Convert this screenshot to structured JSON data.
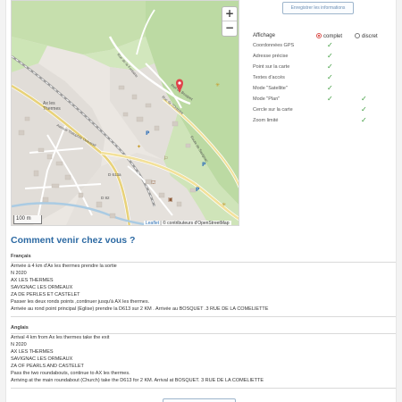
{
  "top_button": {
    "label": "Enregistrer les informations"
  },
  "map": {
    "zoom_in": "+",
    "zoom_out": "−",
    "scale": "100 m",
    "attribution_leaflet": "Leaflet",
    "attribution_osm": " | © contributeurs d'OpenStreetMap",
    "labels": {
      "ax": "Ax les Thermes",
      "road1": "Avenue Théophile Delcassé",
      "road2": "Rue de la Fontaine",
      "road3": "D 613a",
      "road4": "D 82",
      "road5": "Route de Savignac",
      "road6": "Rue de l'Oratoire",
      "road7": "Rue du Bosquet"
    }
  },
  "display_options": {
    "header": "Affichage",
    "mode_complet": "complet",
    "mode_discret": "discret",
    "rows": [
      {
        "label": "Coordonnées GPS",
        "complet": true,
        "discret": false
      },
      {
        "label": "Adresse précise",
        "complet": true,
        "discret": false
      },
      {
        "label": "Point sur la carte",
        "complet": true,
        "discret": false
      },
      {
        "label": "Textes d'accès",
        "complet": true,
        "discret": false
      },
      {
        "label": "Mode \"Satellite\"",
        "complet": true,
        "discret": false
      },
      {
        "label": "Mode \"Plan\"",
        "complet": true,
        "discret": true
      },
      {
        "label": "Cercle sur la carte",
        "complet": false,
        "discret": true
      },
      {
        "label": "Zoom limité",
        "complet": false,
        "discret": true
      }
    ]
  },
  "directions": {
    "title": "Comment venir chez vous ?",
    "francais": {
      "lang": "Français",
      "lines": [
        "Arrivée à 4 km d'Ax les thermes prendre la sortie",
        "N 2020",
        "AX LES THERMES",
        "SAVIGNAC LES ORMEAUX",
        "ZA DE PERLES ET CASTELET",
        "Passer les deux ronds points ,continuer jusqu'à AX les thermes.",
        "Arrivée au rond point principal (Eglise) prendre la D613 sur 2 KM . Arrivée au BOSQUET .3 RUE DE LA COMELIETTE"
      ]
    },
    "anglais": {
      "lang": "Anglais",
      "lines": [
        "Arrival 4 km from Ax les thermes take the exit",
        "N 2020",
        "AX LES THERMES",
        "SAVIGNAC LES ORMEAUX",
        "ZA OF PEARLS AND CASTELET",
        "Pass the two roundabouts, continue to AX les thermes.",
        "Arriving at the main roundabout (Church) take the D613 for 2 KM. Arrival at BOSQUET. 3 RUE DE LA COMELIETTE"
      ]
    }
  },
  "colors": {
    "accent": "#2d6aa3",
    "check": "#3c9b3c",
    "radio_selected": "#e0534f",
    "map_pin": "#e0434a"
  }
}
